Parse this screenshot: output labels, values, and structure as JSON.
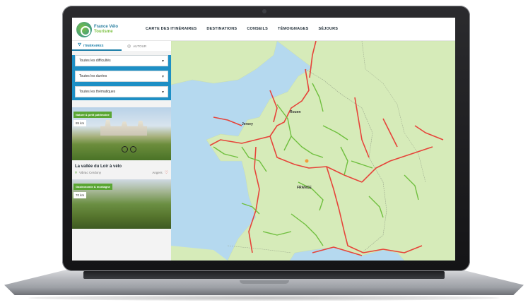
{
  "header": {
    "logo_line1": "France Vélo",
    "logo_line2": "Tourisme",
    "nav": [
      "CARTE DES ITINÉRAIRES",
      "DESTINATIONS",
      "CONSEILS",
      "TÉMOIGNAGES",
      "SÉJOURS"
    ]
  },
  "sidebar": {
    "tabs": [
      {
        "label": "ITINÉRAIRES",
        "icon": "route-icon",
        "active": true
      },
      {
        "label": "AUTOUR",
        "icon": "location-icon",
        "active": false
      }
    ],
    "filters": [
      "Toutes les difficultés",
      "Toutes les durées",
      "Toutes les thématiques"
    ],
    "cards": [
      {
        "badge": "Nature & petit patrimoine",
        "distance": "85 km",
        "title": "La vallée du Loir à vélo",
        "location": "Vibrac Cerdony",
        "tag": "Angers"
      },
      {
        "badge": "Gastronomie & montagne",
        "distance": "70 km",
        "title": "",
        "location": "",
        "tag": ""
      }
    ]
  },
  "map": {
    "country_label": "FRANCE",
    "city_labels": [
      "Jersey",
      "Rouen"
    ],
    "colors": {
      "land": "#d6ebb9",
      "sea": "#b5d9ef",
      "route_main": "#e6443a",
      "route_secondary": "#6fbf3e"
    }
  }
}
